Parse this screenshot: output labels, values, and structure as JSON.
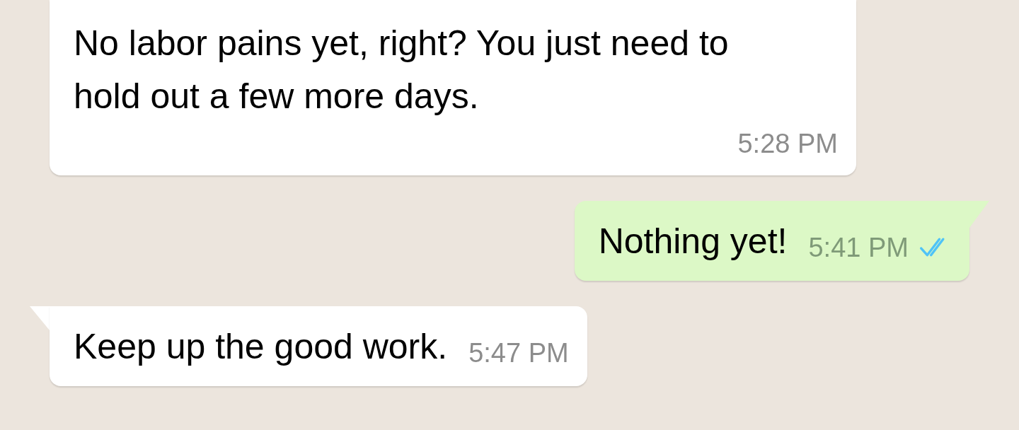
{
  "messages": [
    {
      "kind": "incoming",
      "tail": false,
      "continued": true,
      "text": "No labor pains yet, right? You just need to hold out a few more days.",
      "time": "5:28 PM"
    },
    {
      "kind": "outgoing",
      "tail": true,
      "continued": false,
      "text": "Nothing yet!",
      "time": "5:41 PM",
      "read": true
    },
    {
      "kind": "incoming",
      "tail": true,
      "continued": false,
      "text": "Keep up the good work.",
      "time": "5:47 PM"
    }
  ]
}
